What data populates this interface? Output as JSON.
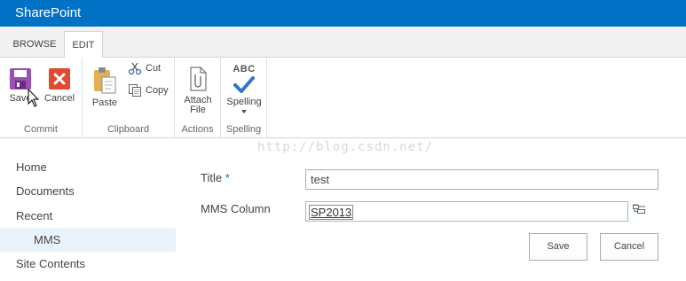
{
  "suite": {
    "brand": "SharePoint"
  },
  "ribbon": {
    "tabs": [
      {
        "label": "BROWSE",
        "active": false
      },
      {
        "label": "EDIT",
        "active": true
      }
    ],
    "groups": {
      "commit": {
        "label": "Commit",
        "save": "Save",
        "cancel": "Cancel"
      },
      "clipboard": {
        "label": "Clipboard",
        "paste": "Paste",
        "cut": "Cut",
        "copy": "Copy"
      },
      "actions": {
        "label": "Actions",
        "attach_line1": "Attach",
        "attach_line2": "File"
      },
      "spelling": {
        "label": "Spelling",
        "spelling": "Spelling",
        "abc": "ABC"
      }
    }
  },
  "watermark": "http://blog.csdn.net/",
  "leftnav": {
    "items": [
      {
        "label": "Home"
      },
      {
        "label": "Documents"
      },
      {
        "label": "Recent"
      },
      {
        "label": "MMS",
        "sub": true
      },
      {
        "label": "Site Contents"
      }
    ]
  },
  "form": {
    "title": {
      "label": "Title",
      "required_mark": "*",
      "value": "test"
    },
    "mms": {
      "label": "MMS Column",
      "value": "SP2013"
    },
    "save": "Save",
    "cancel": "Cancel"
  },
  "colors": {
    "brand": "#0072c6",
    "save_icon": "#9c4fb4",
    "cancel_icon": "#e04a2f"
  }
}
